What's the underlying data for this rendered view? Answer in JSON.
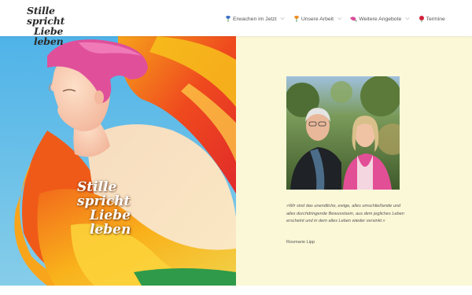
{
  "brand": {
    "logo_line1": "Stille spricht",
    "logo_line2": "Liebe leben"
  },
  "nav": {
    "items": [
      {
        "label": "Erwachen im Jetzt",
        "icon": "flower-blue-icon",
        "color": "#3b6fc4",
        "has_dropdown": true
      },
      {
        "label": "Unsere Arbeit",
        "icon": "flower-orange-icon",
        "color": "#f08a1c",
        "has_dropdown": true
      },
      {
        "label": "Weitere Angebote",
        "icon": "flower-pink-icon",
        "color": "#d94f9c",
        "has_dropdown": true
      },
      {
        "label": "Termine",
        "icon": "flower-red-icon",
        "color": "#d4213c",
        "has_dropdown": false
      }
    ],
    "chevron": "⌵"
  },
  "hero": {
    "title_line1": "Stille spricht",
    "title_line2": "Liebe leben"
  },
  "panel": {
    "background": "#fbf8d8",
    "quote": "»Wir sind das unendliche, ewige, alles umschließende und alles durchdringende Bewusstsein, aus dem jegliches Leben erscheint und in dem alles Leben wieder versinkt.«",
    "author": "Rosmarie Lipp"
  }
}
